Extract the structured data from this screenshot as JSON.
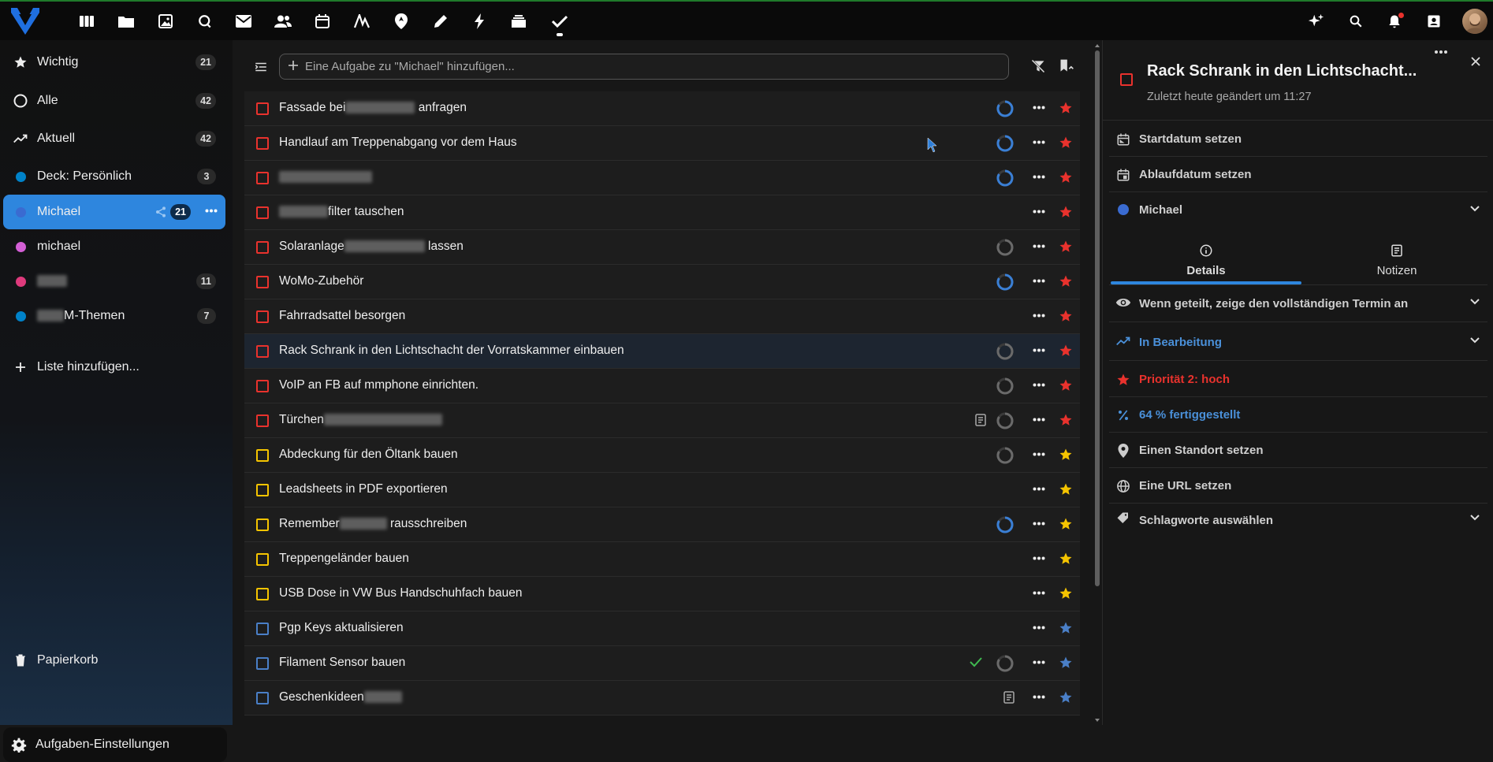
{
  "topbar": {
    "apps": [
      "dashboard-icon",
      "files-icon",
      "photos-icon",
      "search-talk-icon",
      "mail-icon",
      "contacts-icon",
      "calendar-icon",
      "activity-icon",
      "maps-icon",
      "notes-icon",
      "flash-icon",
      "deck-icon",
      "tasks-icon"
    ],
    "right_icons": [
      "assistant-icon",
      "search-icon",
      "bell-icon",
      "contacts-menu-icon"
    ],
    "colors": {
      "accent": "#2e86de",
      "topbar_bg": "#0a0a0a",
      "brand": "#1f6fe0"
    }
  },
  "sidebar": {
    "items": [
      {
        "label": "Wichtig",
        "count": "21",
        "icon": "star-icon"
      },
      {
        "label": "Alle",
        "count": "42",
        "icon": "circle-icon"
      },
      {
        "label": "Aktuell",
        "count": "42",
        "icon": "trend-icon"
      },
      {
        "label": "Deck: Persönlich",
        "count": "3",
        "color": "#0082c9"
      },
      {
        "label": "Michael",
        "count": "21",
        "color": "#3a6bd1",
        "active": true
      },
      {
        "label": "michael",
        "count": "",
        "color": "#d35fd5"
      },
      {
        "label": "",
        "count": "11",
        "color": "#de3a7c"
      },
      {
        "label": "M-Themen",
        "count": "7",
        "color": "#0082c9"
      }
    ],
    "add_list": "Liste hinzufügen...",
    "trash": "Papierkorb",
    "settings": "Aufgaben-Einstellungen"
  },
  "main": {
    "add_placeholder": "Eine Aufgabe zu \"Michael\" hinzufügen...",
    "tasks": [
      {
        "pre": "Fassade bei",
        "post": " anfragen",
        "blur": 88,
        "prio": "red",
        "prog": "blue"
      },
      {
        "pre": "Handlauf am Treppenabgang vor dem Haus",
        "post": "",
        "blur": 0,
        "prio": "red",
        "prog": "blue"
      },
      {
        "pre": "",
        "post": "",
        "blur": 118,
        "prio": "red",
        "prog": "blue"
      },
      {
        "pre": "",
        "post": "filter tauschen",
        "blur": 62,
        "prio": "red",
        "prog": ""
      },
      {
        "pre": "Solaranlage",
        "post": " lassen",
        "blur": 102,
        "prio": "red",
        "prog": "grey"
      },
      {
        "pre": "WoMo-Zubehör",
        "post": "",
        "blur": 0,
        "prio": "red",
        "prog": "blue"
      },
      {
        "pre": "Fahrradsattel besorgen",
        "post": "",
        "blur": 0,
        "prio": "red",
        "prog": ""
      },
      {
        "pre": "Rack Schrank in den Lichtschacht der Vorratskammer einbauen",
        "post": "",
        "blur": 0,
        "prio": "red",
        "prog": "grey",
        "selected": true
      },
      {
        "pre": "VoIP an FB auf mmphone einrichten.",
        "post": "",
        "blur": 0,
        "prio": "red",
        "prog": "grey"
      },
      {
        "pre": "Türchen",
        "post": "",
        "blur": 150,
        "prio": "red",
        "prog": "grey",
        "note": true
      },
      {
        "pre": "Abdeckung für den Öltank bauen",
        "post": "",
        "blur": 0,
        "prio": "yellow",
        "prog": "grey"
      },
      {
        "pre": "Leadsheets in PDF exportieren",
        "post": "",
        "blur": 0,
        "prio": "yellow",
        "prog": ""
      },
      {
        "pre": "Remember",
        "post": " rausschreiben",
        "blur": 60,
        "prio": "yellow",
        "prog": "blue"
      },
      {
        "pre": "Treppengeländer bauen",
        "post": "",
        "blur": 0,
        "prio": "yellow",
        "prog": ""
      },
      {
        "pre": "USB Dose in VW Bus Handschuhfach bauen",
        "post": "",
        "blur": 0,
        "prio": "yellow",
        "prog": ""
      },
      {
        "pre": "Pgp Keys aktualisieren",
        "post": "",
        "blur": 0,
        "prio": "blue",
        "prog": ""
      },
      {
        "pre": "Filament Sensor bauen",
        "post": "",
        "blur": 0,
        "prio": "blue",
        "prog": "grey",
        "check": true
      },
      {
        "pre": "Geschenkideen",
        "post": "",
        "blur": 48,
        "prio": "blue",
        "prog": "",
        "note": true
      }
    ]
  },
  "panel": {
    "title": "Rack Schrank in den Lichtschacht...",
    "subtitle": "Zuletzt heute geändert um 11:27",
    "start": "Startdatum setzen",
    "due": "Ablaufdatum setzen",
    "calendar": "Michael",
    "tab_details": "Details",
    "tab_notes": "Notizen",
    "privacy": "Wenn geteilt, zeige den vollständigen Termin an",
    "status": "In Bearbeitung",
    "priority": "Priorität 2: hoch",
    "complete": "64 % fertiggestellt",
    "location": "Einen Standort setzen",
    "url": "Eine URL setzen",
    "tags": "Schlagworte auswählen",
    "colors": {
      "status": "#4a90d9",
      "priority": "#e9322d",
      "complete": "#4a90d9"
    }
  }
}
